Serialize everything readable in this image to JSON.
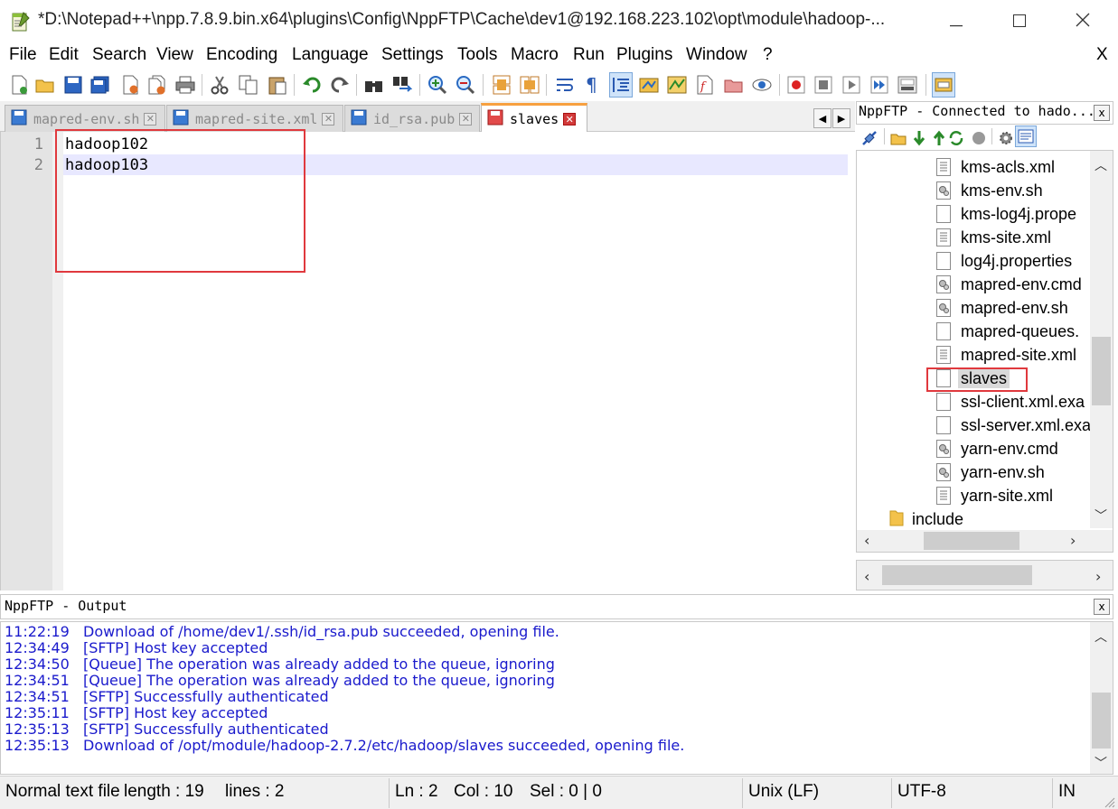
{
  "window": {
    "title": "*D:\\Notepad++\\npp.7.8.9.bin.x64\\plugins\\Config\\NppFTP\\Cache\\dev1@192.168.223.102\\opt\\module\\hadoop-...",
    "minimize_icon": "minimize-icon",
    "maximize_icon": "maximize-icon",
    "close_icon": "close-icon"
  },
  "menubar": {
    "items": [
      "File",
      "Edit",
      "Search",
      "View",
      "Encoding",
      "Language",
      "Settings",
      "Tools",
      "Macro",
      "Run",
      "Plugins",
      "Window",
      "?"
    ],
    "close": "X"
  },
  "tabs": [
    {
      "label": "mapred-env.sh",
      "active": false
    },
    {
      "label": "mapred-site.xml",
      "active": false
    },
    {
      "label": "id_rsa.pub",
      "active": false
    },
    {
      "label": "slaves",
      "active": true
    }
  ],
  "editor": {
    "lines": [
      {
        "number": "1",
        "text": "hadoop102"
      },
      {
        "number": "2",
        "text": "hadoop103"
      }
    ]
  },
  "nppftp": {
    "title": "NppFTP - Connected to hado...",
    "close": "x",
    "tree": [
      {
        "name": "kms-acls.xml",
        "icon": "text-file-icon"
      },
      {
        "name": "kms-env.sh",
        "icon": "script-file-icon"
      },
      {
        "name": "kms-log4j.prope",
        "icon": "blank-file-icon"
      },
      {
        "name": "kms-site.xml",
        "icon": "text-file-icon"
      },
      {
        "name": "log4j.properties",
        "icon": "blank-file-icon"
      },
      {
        "name": "mapred-env.cmd",
        "icon": "script-file-icon"
      },
      {
        "name": "mapred-env.sh",
        "icon": "script-file-icon"
      },
      {
        "name": "mapred-queues.",
        "icon": "blank-file-icon"
      },
      {
        "name": "mapred-site.xml",
        "icon": "text-file-icon"
      },
      {
        "name": "slaves",
        "icon": "blank-file-icon"
      },
      {
        "name": "ssl-client.xml.exa",
        "icon": "blank-file-icon"
      },
      {
        "name": "ssl-server.xml.exa",
        "icon": "blank-file-icon"
      },
      {
        "name": "yarn-env.cmd",
        "icon": "script-file-icon"
      },
      {
        "name": "yarn-env.sh",
        "icon": "script-file-icon"
      },
      {
        "name": "yarn-site.xml",
        "icon": "text-file-icon"
      }
    ],
    "folder": {
      "name": "include",
      "icon": "folder-icon"
    }
  },
  "output": {
    "title": "NppFTP - Output",
    "close": "x",
    "lines": [
      {
        "time": "11:22:19",
        "message": "Download of /home/dev1/.ssh/id_rsa.pub succeeded, opening file."
      },
      {
        "time": "12:34:49",
        "message": "[SFTP] Host key accepted"
      },
      {
        "time": "12:34:50",
        "message": "[Queue] The operation was already added to the queue, ignoring"
      },
      {
        "time": "12:34:51",
        "message": "[Queue] The operation was already added to the queue, ignoring"
      },
      {
        "time": "12:34:51",
        "message": "[SFTP] Successfully authenticated"
      },
      {
        "time": "12:35:11",
        "message": "[SFTP] Host key accepted"
      },
      {
        "time": "12:35:13",
        "message": "[SFTP] Successfully authenticated"
      },
      {
        "time": "12:35:13",
        "message": "Download of /opt/module/hadoop-2.7.2/etc/hadoop/slaves succeeded, opening file."
      }
    ]
  },
  "statusbar": {
    "file_type": "Normal text file",
    "length": "length : 19",
    "lines": "lines : 2",
    "ln": "Ln : 2",
    "col": "Col : 10",
    "sel": "Sel : 0 | 0",
    "eol": "Unix (LF)",
    "encoding": "UTF-8",
    "mode": "IN"
  },
  "colors": {
    "highlight_box": "#e0393e",
    "current_line": "#e8e8ff",
    "log_text": "#1a1acc",
    "active_tab_accent": "#f7a040"
  }
}
